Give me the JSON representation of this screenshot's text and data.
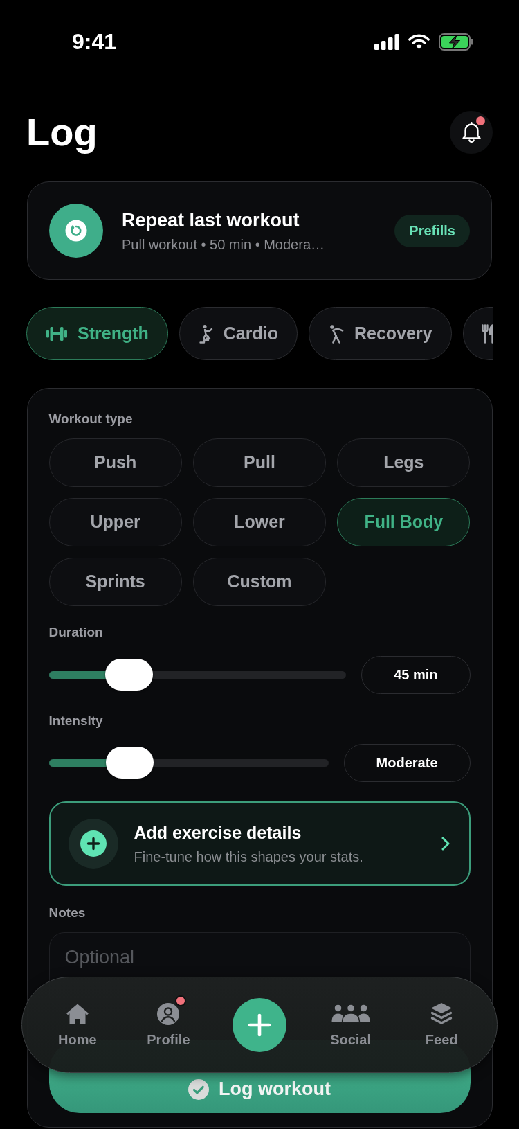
{
  "status_bar": {
    "time": "9:41"
  },
  "header": {
    "title": "Log",
    "has_unread": true
  },
  "repeat_card": {
    "title": "Repeat last workout",
    "subtitle": "Pull workout • 50 min • Modera…",
    "action": "Prefills"
  },
  "categories": [
    {
      "label": "Strength",
      "selected": true
    },
    {
      "label": "Cardio",
      "selected": false
    },
    {
      "label": "Recovery",
      "selected": false
    },
    {
      "selected": false
    }
  ],
  "workout_type": {
    "label": "Workout type",
    "options": [
      {
        "label": "Push",
        "selected": false
      },
      {
        "label": "Pull",
        "selected": false
      },
      {
        "label": "Legs",
        "selected": false
      },
      {
        "label": "Upper",
        "selected": false
      },
      {
        "label": "Lower",
        "selected": false
      },
      {
        "label": "Full Body",
        "selected": true
      },
      {
        "label": "Sprints",
        "selected": false
      },
      {
        "label": "Custom",
        "selected": false
      }
    ]
  },
  "sliders": [
    {
      "label": "Duration",
      "level": 0.27,
      "value": "45 min"
    },
    {
      "label": "Intensity",
      "level": 0.29,
      "value": "Moderate"
    }
  ],
  "details_card": {
    "title": "Add exercise details",
    "subtitle": "Fine-tune how this shapes your stats."
  },
  "notes": {
    "label": "Notes",
    "placeholder": "Optional"
  },
  "submit_button": {
    "label": "Log workout"
  },
  "tab_bar": {
    "items": [
      {
        "kind": "tab",
        "label": "Home",
        "selected": false,
        "badge": false
      },
      {
        "kind": "tab",
        "label": "Profile",
        "selected": false,
        "badge": true
      },
      {
        "kind": "add"
      },
      {
        "kind": "tab",
        "label": "Social",
        "selected": false,
        "badge": false
      },
      {
        "kind": "tab",
        "label": "Feed",
        "selected": false,
        "badge": false
      }
    ]
  }
}
